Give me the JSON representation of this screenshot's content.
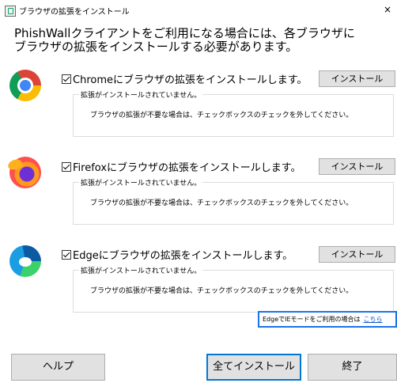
{
  "window": {
    "title": "ブラウザの拡張をインストール",
    "close_label": "×"
  },
  "heading": {
    "line1": "PhishWallクライアントをご利用になる場合には、各ブラウザに",
    "line2": "ブラウザの拡張をインストールする必要があります。"
  },
  "browsers": [
    {
      "icon": "chrome-icon",
      "checked": true,
      "label": "Chromeにブラウザの拡張をインストールします。",
      "button": "インストール",
      "status": "拡張がインストールされていません。",
      "note": "ブラウザの拡張が不要な場合は、チェックボックスのチェックを外してください。"
    },
    {
      "icon": "firefox-icon",
      "checked": true,
      "label": "Firefoxにブラウザの拡張をインストールします。",
      "button": "インストール",
      "status": "拡張がインストールされていません。",
      "note": "ブラウザの拡張が不要な場合は、チェックボックスのチェックを外してください。"
    },
    {
      "icon": "edge-icon",
      "checked": true,
      "label": "Edgeにブラウザの拡張をインストールします。",
      "button": "インストール",
      "status": "拡張がインストールされていません。",
      "note": "ブラウザの拡張が不要な場合は、チェックボックスのチェックを外してください。"
    }
  ],
  "edge_ie_mode": {
    "text": "EdgeでIEモードをご利用の場合は",
    "link": "こちら",
    "accent_color": "#1a73e8"
  },
  "footer": {
    "help_label": "ヘルプ",
    "install_all_label": "全てインストール",
    "finish_label": "終了"
  }
}
